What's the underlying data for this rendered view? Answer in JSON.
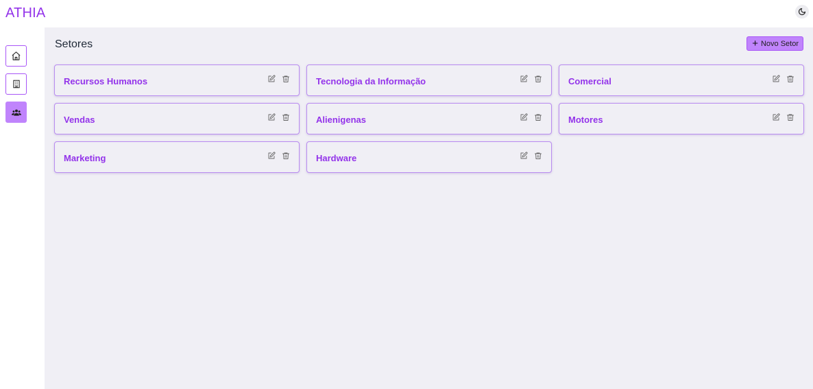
{
  "app": {
    "brand": "ATHIA"
  },
  "header": {
    "theme_icon": "moon-icon"
  },
  "sidebar": {
    "items": [
      {
        "name": "home",
        "icon": "home-icon",
        "active": false
      },
      {
        "name": "building",
        "icon": "building-icon",
        "active": false
      },
      {
        "name": "users",
        "icon": "users-icon",
        "active": true
      }
    ]
  },
  "main": {
    "title": "Setores",
    "new_button_label": "Novo Setor"
  },
  "sectors": [
    {
      "name": "Recursos Humanos"
    },
    {
      "name": "Tecnologia da Informação"
    },
    {
      "name": "Comercial"
    },
    {
      "name": "Vendas"
    },
    {
      "name": "Alienigenas"
    },
    {
      "name": "Motores"
    },
    {
      "name": "Marketing"
    },
    {
      "name": "Hardware"
    }
  ],
  "colors": {
    "accent": "#9333ea",
    "accent_light": "#c084fc",
    "panel_bg": "#f0eff5"
  }
}
